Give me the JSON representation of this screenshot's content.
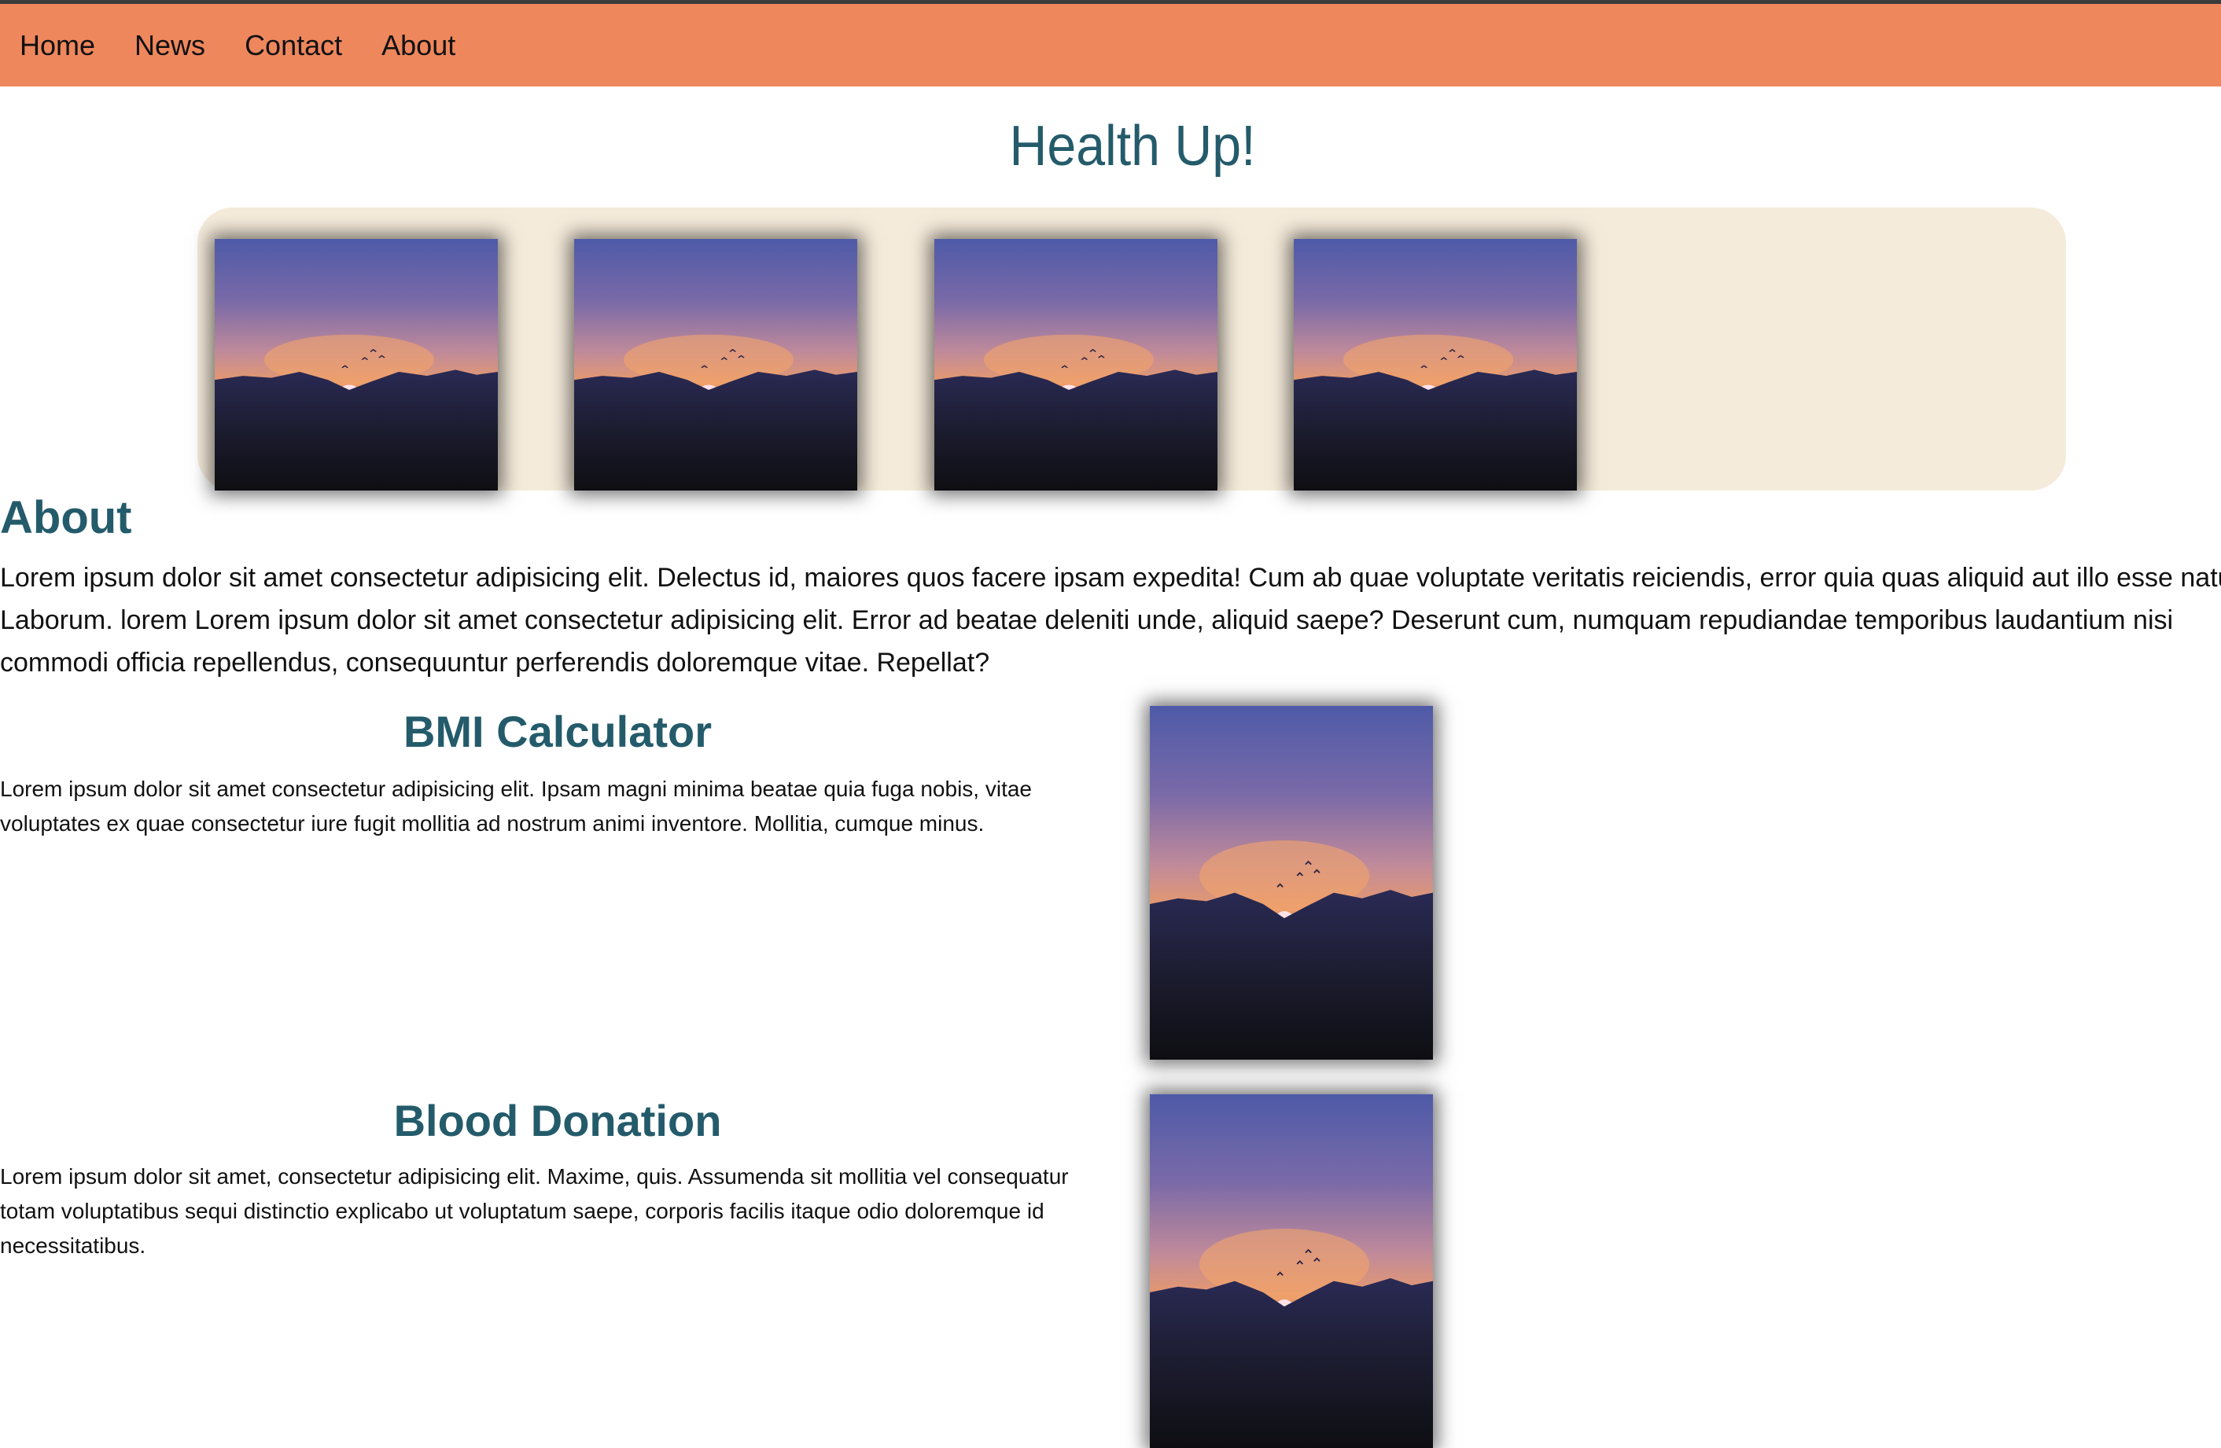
{
  "nav": {
    "items": [
      "Home",
      "News",
      "Contact",
      "About"
    ]
  },
  "site": {
    "title": "Health Up!"
  },
  "gallery": {
    "image_icon": "sunset-mountain-photo",
    "count": 4
  },
  "about": {
    "heading": "About",
    "text": "Lorem ipsum dolor sit amet consectetur adipisicing elit. Delectus id, maiores quos facere ipsam expedita! Cum ab quae voluptate veritatis reiciendis, error quia quas aliquid aut illo esse natus. Laborum. lorem Lorem ipsum dolor sit amet consectetur adipisicing elit. Error ad beatae deleniti unde, aliquid saepe? Deserunt cum, numquam repudiandae temporibus laudantium nisi commodi officia repellendus, consequuntur perferendis doloremque vitae. Repellat?"
  },
  "cards": [
    {
      "title": "BMI Calculator",
      "text": "Lorem ipsum dolor sit amet consectetur adipisicing elit. Ipsam magni minima beatae quia fuga nobis, vitae voluptates ex quae consectetur iure fugit mollitia ad nostrum animi inventore. Mollitia, cumque minus."
    },
    {
      "title": "Blood Donation",
      "text": "Lorem ipsum dolor sit amet, consectetur adipisicing elit. Maxime, quis. Assumenda sit mollitia vel consequatur totam voluptatibus sequi distinctio explicabo ut voluptatum saepe, corporis facilis itaque odio doloremque id necessitatibus."
    }
  ],
  "colors": {
    "nav_bg": "#ef875d",
    "accent": "#245b6b",
    "gallery_bg": "#f5ebdb"
  }
}
